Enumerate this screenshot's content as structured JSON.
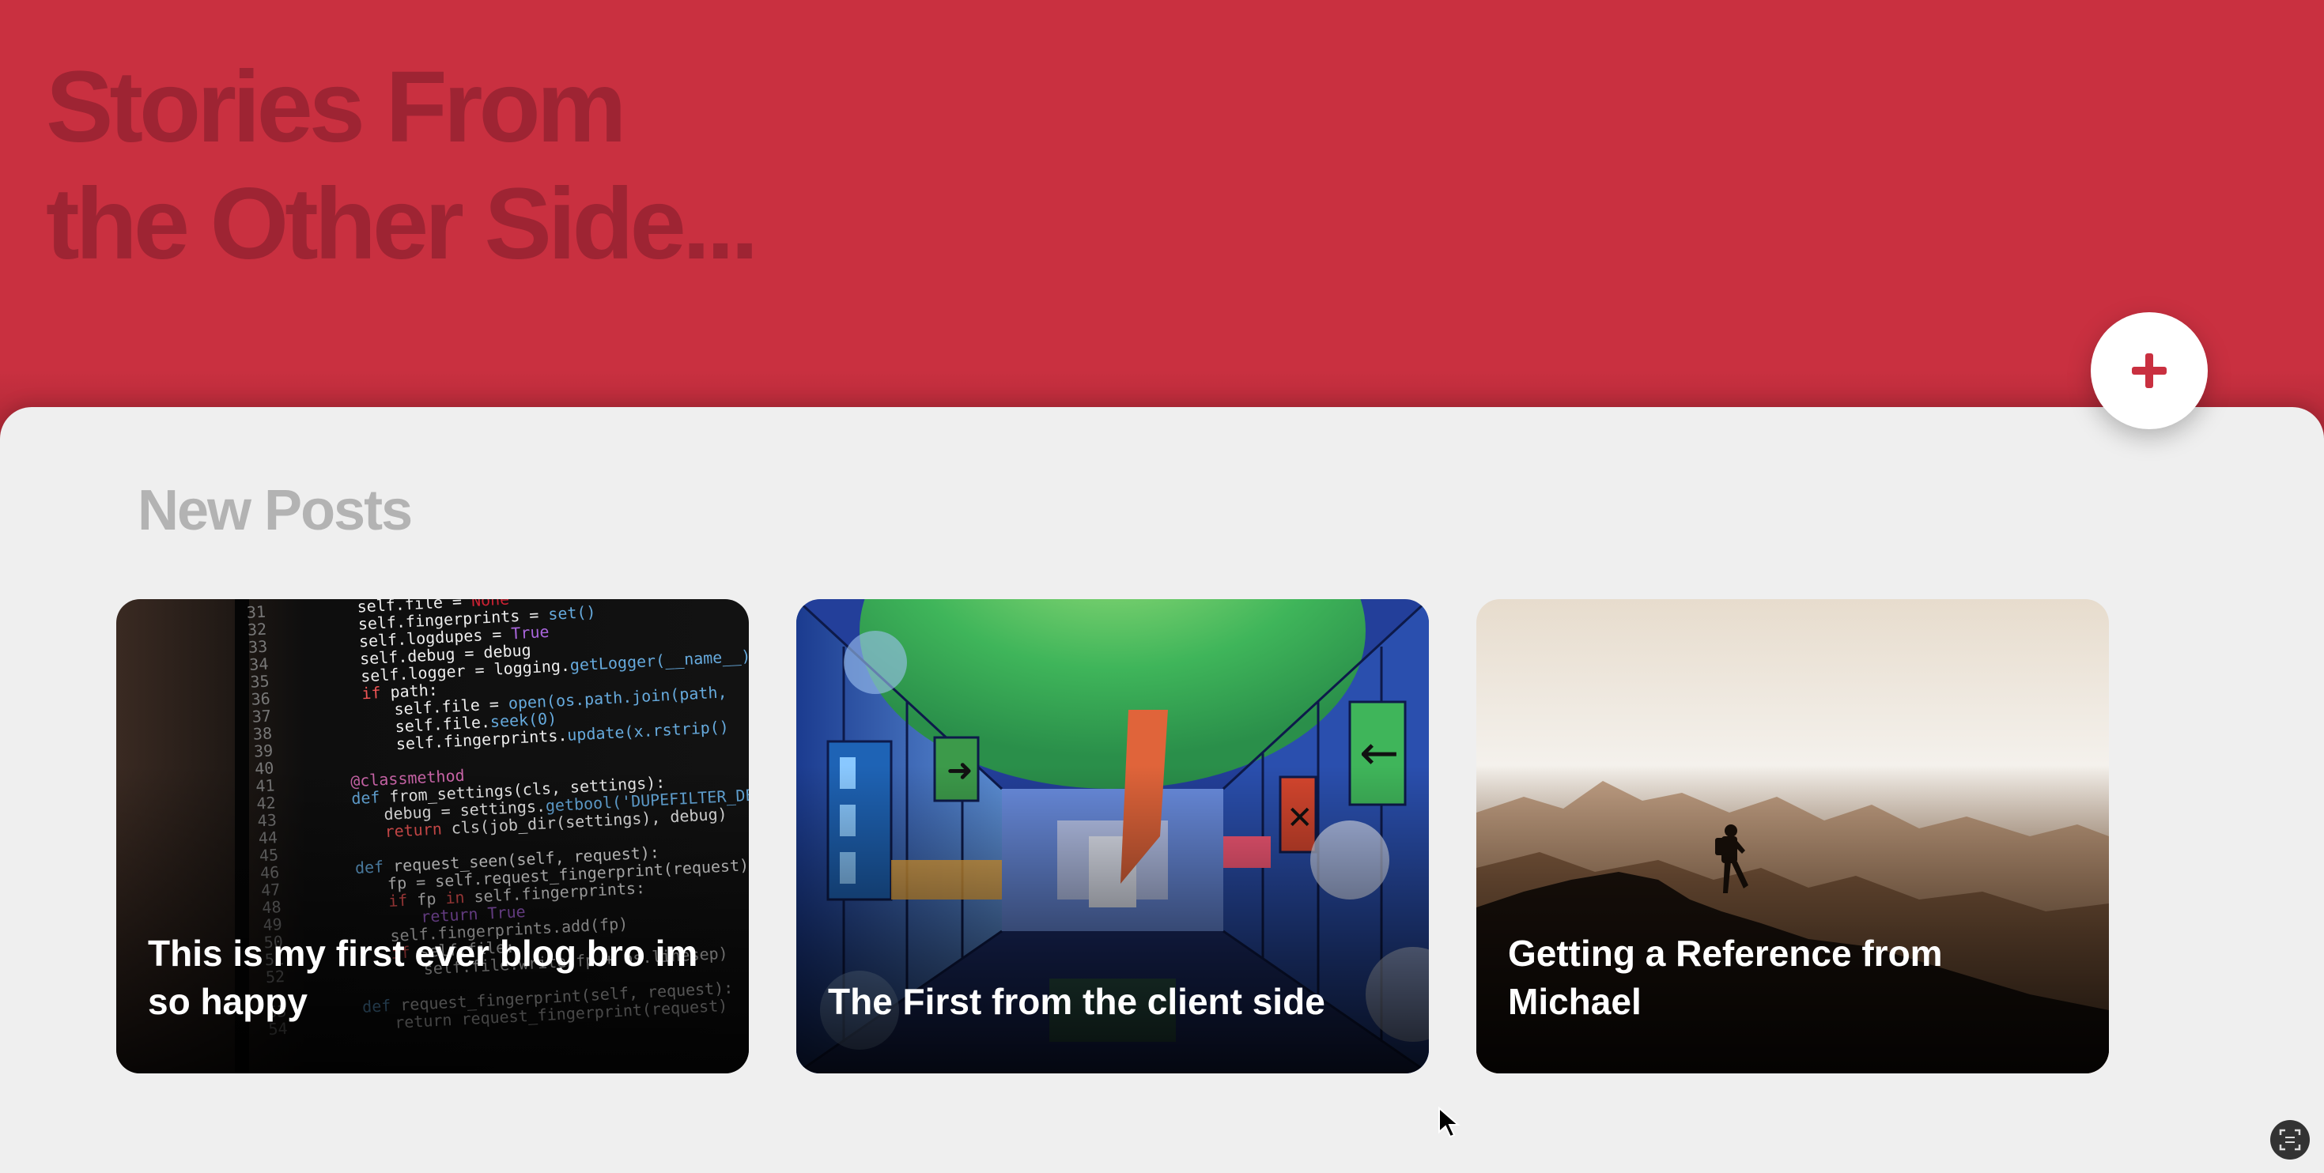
{
  "hero": {
    "title_line1": "Stories From",
    "title_line2": "the Other Side..."
  },
  "add_button": {
    "icon": "plus-icon"
  },
  "new_posts": {
    "heading": "New Posts",
    "posts": [
      {
        "title": "This is my first ever blog bro im so happy",
        "image": "code-editor-photo"
      },
      {
        "title": "The First from the client side",
        "image": "colorful-corridor-illustration"
      },
      {
        "title": "Getting a Reference from Michael",
        "image": "hiker-mountain-silhouette"
      }
    ]
  },
  "colors": {
    "brand_red": "#c93040",
    "title_dark_red": "#9e2433",
    "panel_background": "#efefef",
    "heading_gray": "#b3b3b3"
  }
}
